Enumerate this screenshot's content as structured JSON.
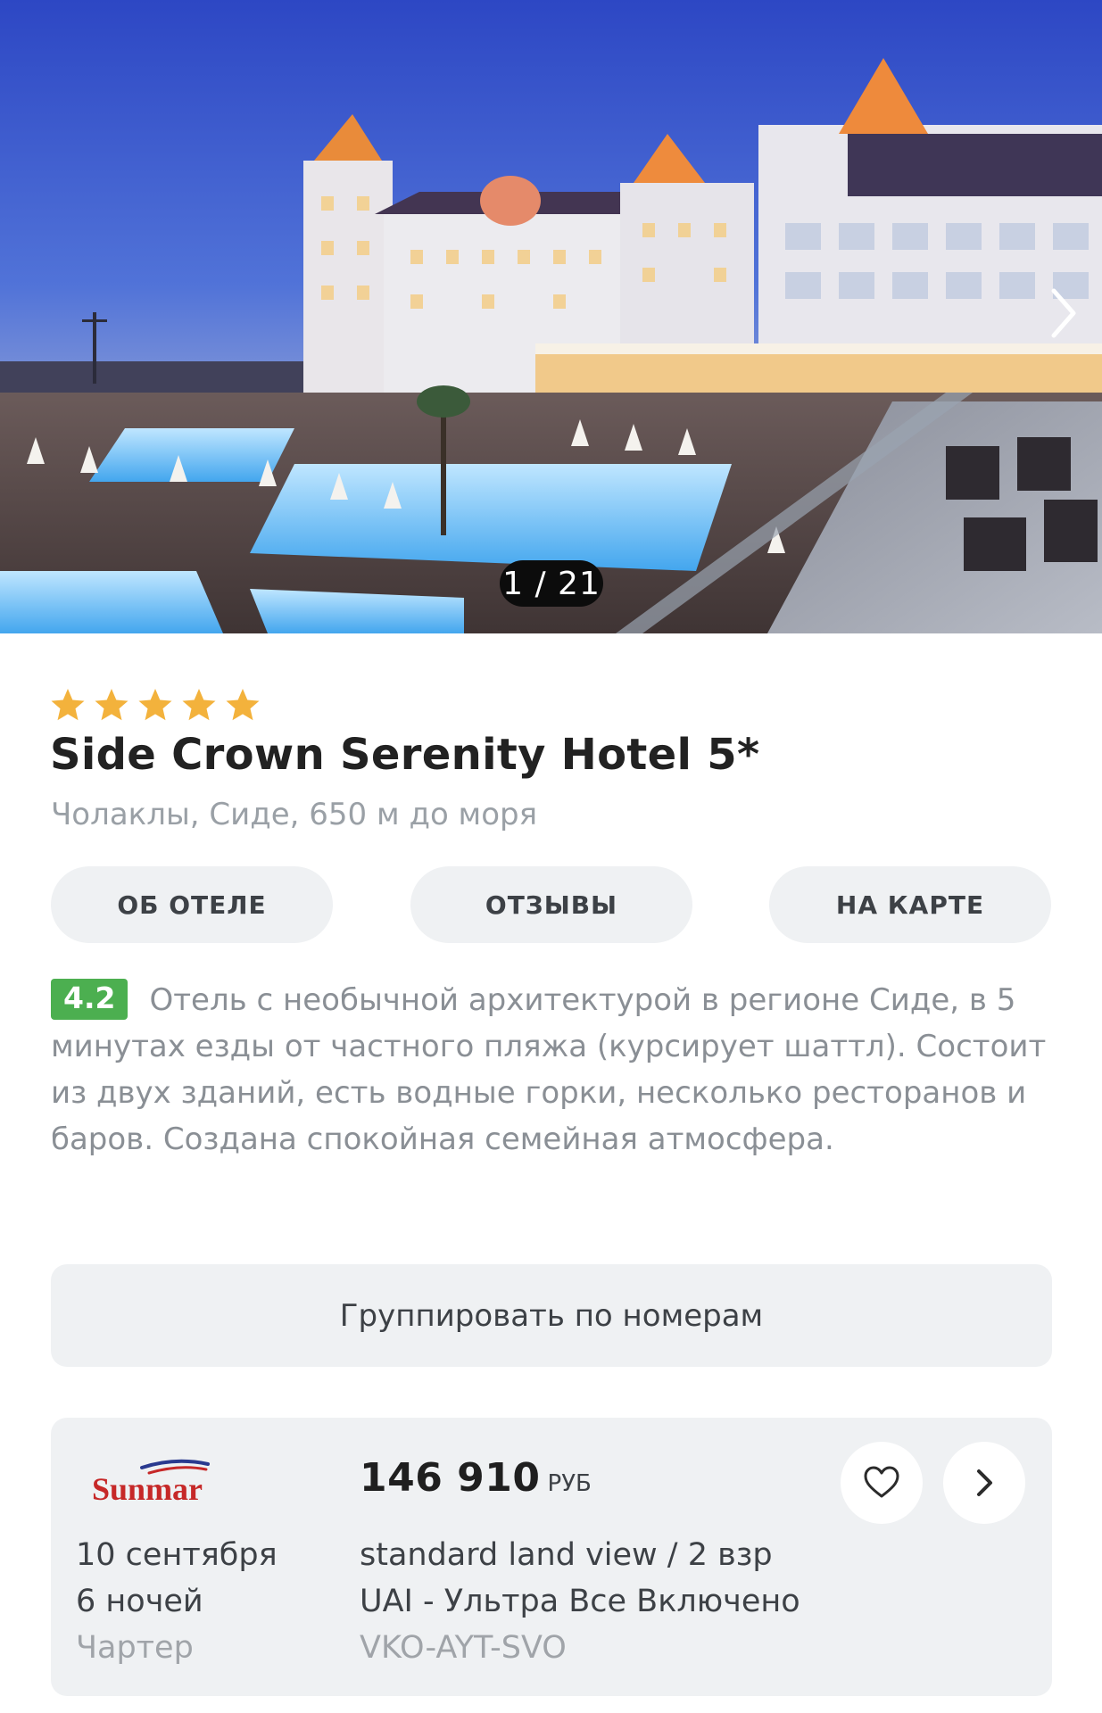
{
  "gallery": {
    "counter": "1 / 21",
    "next_icon": "chevron-right-icon"
  },
  "hotel": {
    "stars": 5,
    "star_color": "#f3b23c",
    "name": "Side Crown Serenity Hotel 5*",
    "location": "Чолаклы, Сиде, 650 м до моря"
  },
  "tabs": {
    "about": "ОБ ОТЕЛЕ",
    "reviews": "ОТЗЫВЫ",
    "map": "НА КАРТЕ"
  },
  "description": {
    "rating": "4.2",
    "rating_color": "#4caf50",
    "text": "Отель с необычной архитектурой в регионе Сиде, в 5 минутах езды от частного пляжа (курсирует шаттл). Состоит из двух зданий, есть водные горки, несколько ресторанов и баров. Создана спокойная семейная атмосфера."
  },
  "group_button": "Группировать по номерам",
  "offer": {
    "operator_logo": "Sunmar",
    "operator_color": "#c62828",
    "date": "10 сентября",
    "nights": "6 ночей",
    "flight_type": "Чартер",
    "price": "146 910",
    "currency": "РУБ",
    "room": "standard land view / 2 взр",
    "meal": "UAI - Ультра Все Включено",
    "route": "VKO-AYT-SVO",
    "favorite_icon": "heart-icon",
    "details_icon": "chevron-right-icon"
  }
}
